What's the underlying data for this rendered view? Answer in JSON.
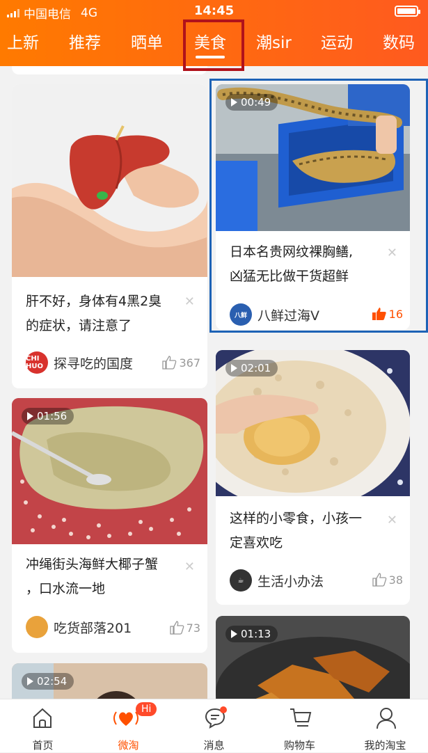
{
  "status_bar": {
    "carrier": "中国电信",
    "network": "4G",
    "time": "14:45"
  },
  "tabs": [
    "上新",
    "推荐",
    "晒单",
    "美食",
    "潮sir",
    "运动",
    "数码"
  ],
  "active_tab": "美食",
  "cards": [
    {
      "title_lines": [
        "肝不好，身体有4黑2臭",
        "的症状，请注意了"
      ],
      "author": "探寻吃的国度",
      "avatar_text": "CHI HUO",
      "likes": "367",
      "liked": false
    },
    {
      "duration": "00:49",
      "title_lines": [
        "日本名贵网纹裸胸鳝,",
        "凶猛无比做干货超鲜"
      ],
      "author": "八鲜过海V",
      "avatar_text": "八鲜",
      "likes": "16",
      "liked": true
    },
    {
      "duration": "01:56",
      "title_lines": [
        "冲绳街头海鲜大椰子蟹",
        "，口水流一地"
      ],
      "author": "吃货部落201",
      "likes": "73",
      "liked": false
    },
    {
      "duration": "02:01",
      "title_lines": [
        "这样的小零食，小孩一",
        "定喜欢吃"
      ],
      "author": "生活小办法",
      "likes": "38",
      "liked": false
    },
    {
      "duration": "02:54"
    },
    {
      "duration": "01:13"
    }
  ],
  "bottom_nav": [
    {
      "label": "首页",
      "icon": "home-icon"
    },
    {
      "label": "微淘",
      "icon": "heart-wave-icon",
      "badge": "Hi"
    },
    {
      "label": "消息",
      "icon": "chat-bubble-icon"
    },
    {
      "label": "购物车",
      "icon": "cart-icon"
    },
    {
      "label": "我的淘宝",
      "icon": "person-icon"
    }
  ],
  "colors": {
    "accent": "#ff6a00",
    "annotation_red": "#b0121b",
    "annotation_blue": "#1d62b6",
    "active_nav": "#ff5000"
  }
}
